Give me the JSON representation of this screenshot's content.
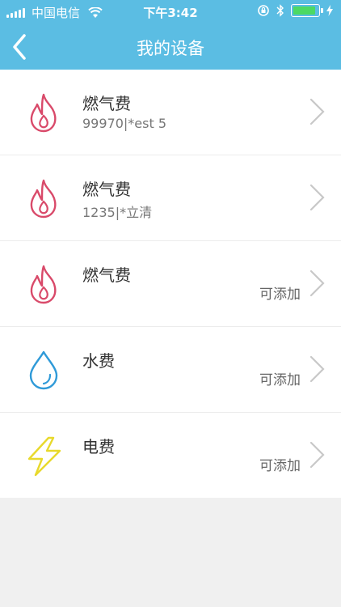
{
  "statusbar": {
    "carrier": "中国电信",
    "time": "下午3:42"
  },
  "nav": {
    "title": "我的设备",
    "back_icon": "chevron-left-icon"
  },
  "devices": [
    {
      "name": "燃气费",
      "subtitle": "99970|*est 5",
      "action": "",
      "icon": "flame-icon",
      "color": "#d94a6a"
    },
    {
      "name": "燃气费",
      "subtitle": "1235|*立清",
      "action": "",
      "icon": "flame-icon",
      "color": "#d94a6a"
    },
    {
      "name": "燃气费",
      "subtitle": "",
      "action": "可添加",
      "icon": "flame-icon",
      "color": "#d94a6a"
    },
    {
      "name": "水费",
      "subtitle": "",
      "action": "可添加",
      "icon": "water-drop-icon",
      "color": "#2f9ad8"
    },
    {
      "name": "电费",
      "subtitle": "",
      "action": "可添加",
      "icon": "lightning-icon",
      "color": "#f0e23a"
    }
  ],
  "colors": {
    "header": "#5bbde3",
    "background": "#f0f0f0"
  }
}
